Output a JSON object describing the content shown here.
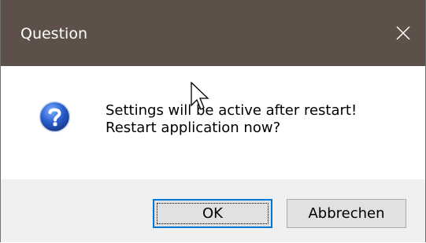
{
  "window": {
    "title": "Question",
    "close_icon": "close-icon",
    "titlebar_color": "#5c5048"
  },
  "message": {
    "icon": "question-icon",
    "line1": "Settings will be active after restart!",
    "line2": "Restart application now?"
  },
  "buttons": {
    "ok_label": "OK",
    "cancel_label": "Abbrechen",
    "focus_color": "#0078d7"
  },
  "cursor": "mouse-pointer-icon"
}
